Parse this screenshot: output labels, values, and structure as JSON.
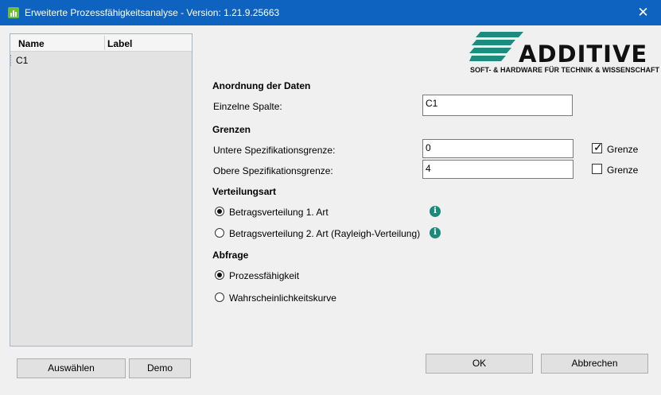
{
  "window": {
    "title": "Erweiterte Prozessfähigkeitsanalyse - Version: 1.21.9.25663",
    "close_symbol": "✕"
  },
  "columns_list": {
    "headers": {
      "name": "Name",
      "label": "Label"
    },
    "rows": [
      {
        "name": "C1",
        "label": ""
      }
    ]
  },
  "buttons": {
    "select": "Auswählen",
    "demo": "Demo",
    "ok": "OK",
    "cancel": "Abbrechen"
  },
  "logo": {
    "word": "ADDITIVE",
    "tagline": "SOFT- & HARDWARE FÜR TECHNIK & WISSENSCHAFT"
  },
  "data_arrangement": {
    "title": "Anordnung der Daten",
    "single_column_label": "Einzelne Spalte:",
    "single_column_value": "C1"
  },
  "limits": {
    "title": "Grenzen",
    "lower_label": "Untere Spezifikationsgrenze:",
    "lower_value": "0",
    "lower_bound_label": "Grenze",
    "lower_bound_checked": true,
    "upper_label": "Obere Spezifikationsgrenze:",
    "upper_value": "4",
    "upper_bound_label": "Grenze",
    "upper_bound_checked": false
  },
  "distribution": {
    "title": "Verteilungsart",
    "options": [
      {
        "label": "Betragsverteilung 1. Art",
        "selected": true
      },
      {
        "label": "Betragsverteilung 2. Art (Rayleigh-Verteilung)",
        "selected": false
      }
    ],
    "info_symbol": "i"
  },
  "query": {
    "title": "Abfrage",
    "options": [
      {
        "label": "Prozessfähigkeit",
        "selected": true
      },
      {
        "label": "Wahrscheinlichkeitskurve",
        "selected": false
      }
    ]
  },
  "colors": {
    "titlebar": "#0f63c0",
    "logo_teal": "#1a8c80",
    "info_icon": "#1c8a7a"
  }
}
